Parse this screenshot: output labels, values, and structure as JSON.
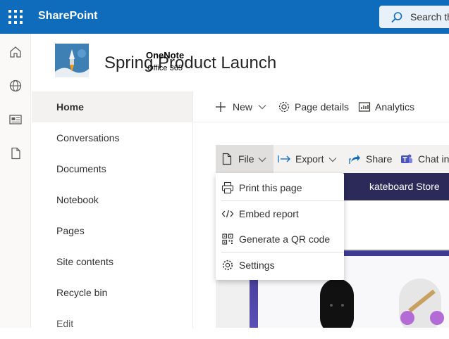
{
  "header": {
    "brand": "SharePoint",
    "search_placeholder": "Search th"
  },
  "rail": {
    "icons": [
      "home-icon",
      "globe-icon",
      "news-icon",
      "document-icon"
    ]
  },
  "site": {
    "title": "Spring Product Launch"
  },
  "leftnav": {
    "items": [
      {
        "label": "Home",
        "active": true
      },
      {
        "label": "Conversations"
      },
      {
        "label": "Documents"
      },
      {
        "label": "Notebook"
      },
      {
        "label": "Pages"
      },
      {
        "label": "Site contents"
      },
      {
        "label": "Recycle bin"
      },
      {
        "label": "Edit"
      }
    ]
  },
  "commandbar": {
    "new_label": "New",
    "page_details_label": "Page details",
    "analytics_label": "Analytics"
  },
  "powerbi_toolbar": {
    "file_label": "File",
    "export_label": "Export",
    "share_label": "Share",
    "chat_label": "Chat in"
  },
  "file_menu": {
    "items": [
      {
        "label": "Print this page",
        "icon": "printer-icon"
      },
      {
        "label": "Embed report",
        "icon": "code-icon"
      },
      {
        "label": "Generate a QR code",
        "icon": "qr-code-icon"
      },
      {
        "label": "Settings",
        "icon": "settings-icon"
      }
    ]
  },
  "report": {
    "banner_text": "kateboard Store",
    "tile_name": "OneNote",
    "tile_sub": "Office 365"
  },
  "colors": {
    "brand_blue": "#0f6cbd",
    "nav_active": "#f3f2f1",
    "report_banner": "#2b2a58"
  }
}
